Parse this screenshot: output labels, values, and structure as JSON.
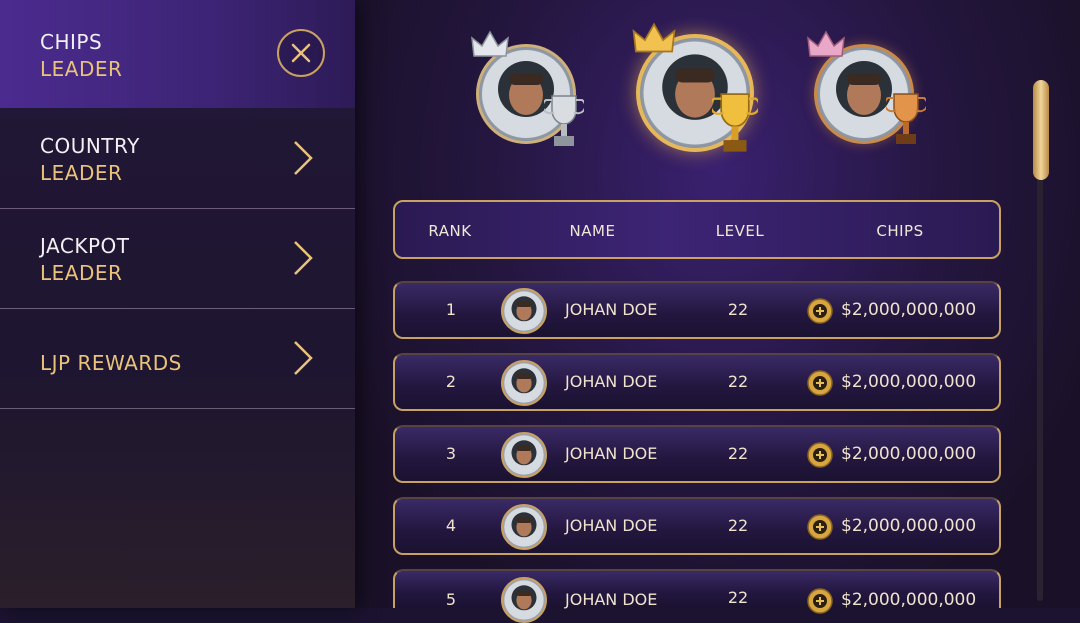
{
  "sidebar": {
    "items": [
      {
        "line1": "CHIPS",
        "line2": "LEADER",
        "active": true
      },
      {
        "line1": "COUNTRY",
        "line2": "LEADER"
      },
      {
        "line1": "JACKPOT",
        "line2": "LEADER"
      },
      {
        "line1": "LJP REWARDS",
        "line2": ""
      }
    ],
    "close_icon": "close-icon",
    "chevron_icon": "chevron-right-icon"
  },
  "podium": [
    {
      "place": 2,
      "crown": "silver-crown-icon",
      "trophy": "silver-trophy-icon"
    },
    {
      "place": 1,
      "crown": "gold-crown-icon",
      "trophy": "gold-trophy-icon"
    },
    {
      "place": 3,
      "crown": "bronze-crown-icon",
      "trophy": "bronze-trophy-icon"
    }
  ],
  "table": {
    "headers": {
      "rank": "RANK",
      "name": "NAME",
      "level": "LEVEL",
      "chips": "CHIPS"
    },
    "rows": [
      {
        "rank": "1",
        "name": "JOHAN DOE",
        "level": "22",
        "chips": "$2,000,000,000"
      },
      {
        "rank": "2",
        "name": "JOHAN DOE",
        "level": "22",
        "chips": "$2,000,000,000"
      },
      {
        "rank": "3",
        "name": "JOHAN DOE",
        "level": "22",
        "chips": "$2,000,000,000"
      },
      {
        "rank": "4",
        "name": "JOHAN DOE",
        "level": "22",
        "chips": "$2,000,000,000"
      },
      {
        "rank": "5",
        "name": "JOHAN DOE",
        "level": "22",
        "chips": "$2,000,000,000"
      }
    ]
  },
  "colors": {
    "gold": "#c9a261",
    "accent_text": "#e9c37a",
    "active_tab": "#4b2b8f"
  }
}
